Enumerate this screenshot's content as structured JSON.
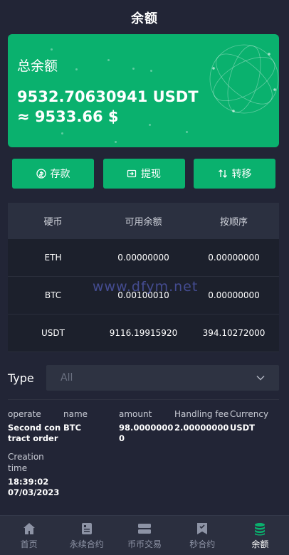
{
  "header": {
    "title": "余额"
  },
  "balance": {
    "label": "总余额",
    "usdt": "9532.70630941 USDT",
    "usd": "≈ 9533.66 $"
  },
  "actions": [
    {
      "label": "存款",
      "icon": "deposit-icon"
    },
    {
      "label": "提现",
      "icon": "withdraw-icon"
    },
    {
      "label": "转移",
      "icon": "transfer-icon"
    }
  ],
  "table": {
    "headers": [
      "硬币",
      "可用余额",
      "按顺序"
    ],
    "rows": [
      [
        "ETH",
        "0.00000000",
        "0.00000000"
      ],
      [
        "BTC",
        "0.00100010",
        "0.00000000"
      ],
      [
        "USDT",
        "9116.19915920",
        "394.10272000"
      ]
    ]
  },
  "watermark": "www.dfym.net",
  "filter": {
    "label": "Type",
    "selected": "All"
  },
  "records": {
    "headers": [
      "operate",
      "name",
      "amount",
      "Handling fee",
      "Currency"
    ],
    "values": [
      "Second contract order",
      "BTC",
      "98.00000000",
      "2.00000000",
      "USDT"
    ],
    "creation_label": "Creation time",
    "creation_value": "18:39:02 07/03/2023"
  },
  "tabbar": [
    {
      "label": "首页",
      "icon": "home-icon"
    },
    {
      "label": "永续合约",
      "icon": "contract-icon"
    },
    {
      "label": "币币交易",
      "icon": "exchange-icon"
    },
    {
      "label": "秒合约",
      "icon": "second-contract-icon"
    },
    {
      "label": "余额",
      "icon": "balance-icon",
      "active": true
    }
  ],
  "colors": {
    "accent": "#0ab16e",
    "background": "#222536"
  }
}
